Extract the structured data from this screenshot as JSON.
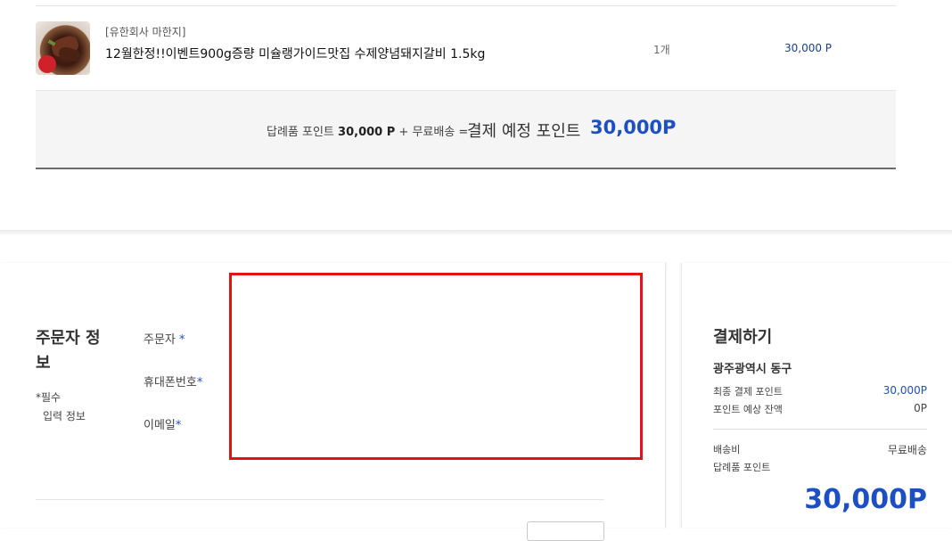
{
  "product": {
    "seller": "[유한회사 마한지]",
    "name": "12월한정!!이벤트900g증량 미슐랭가이드맛집 수제양념돼지갈비 1.5kg",
    "quantity": "1개",
    "price": "30,000 P"
  },
  "summary": {
    "gift_points_label": "답례품 포인트",
    "gift_points_value": "30,000 P",
    "shipping": "+ 무료배송 =",
    "expected_label": "결제 예정 포인트",
    "expected_value": "30,000P"
  },
  "orderer": {
    "section_title": "주문자 정보",
    "required_note_line1": "*필수",
    "required_note_line2": "입력 정보",
    "fields": [
      {
        "label": "주문자",
        "star": " *"
      },
      {
        "label": "휴대폰번호",
        "star": "*"
      },
      {
        "label": "이메일",
        "star": "*"
      }
    ]
  },
  "payment": {
    "title": "결제하기",
    "region": "광주광역시 동구",
    "final_points_label": "최종 결제 포인트",
    "final_points_value": "30,000P",
    "balance_label": "포인트 예상 잔액",
    "balance_value": "0P",
    "shipping_label": "배송비",
    "shipping_value": "무료배송",
    "gift_points_label": "답례품 포인트",
    "total": "30,000P"
  },
  "colors": {
    "accent_blue": "#1d4fc4",
    "highlight_red": "#e11414"
  }
}
